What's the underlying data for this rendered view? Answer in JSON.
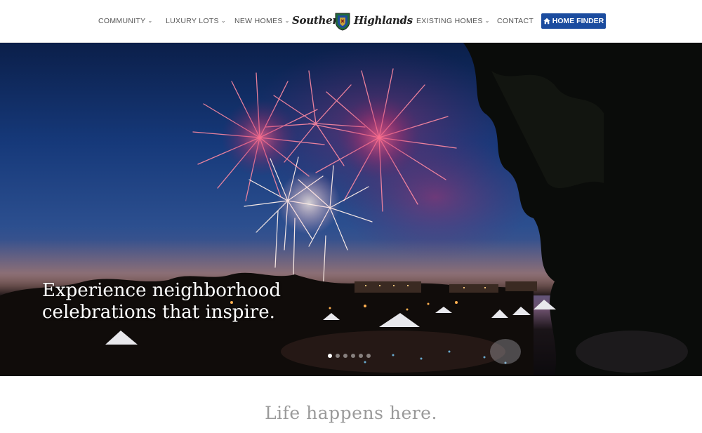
{
  "nav": {
    "items": [
      {
        "label": "COMMUNITY",
        "has_dropdown": true
      },
      {
        "label": "LUXURY LOTS",
        "has_dropdown": true
      },
      {
        "label": "NEW HOMES",
        "has_dropdown": true
      },
      {
        "label": "EXISTING HOMES",
        "has_dropdown": true
      },
      {
        "label": "CONTACT",
        "has_dropdown": false
      }
    ],
    "logo": {
      "left_text": "Southern",
      "right_text": "Highlands",
      "reg": "®"
    },
    "home_finder": {
      "label": "HOME FINDER",
      "icon": "home-icon",
      "color": "#1b4c9f"
    }
  },
  "hero": {
    "caption_line1": "Experience neighborhood",
    "caption_line2": "celebrations that inspire.",
    "slides": 6,
    "active_slide": 1
  },
  "intro": {
    "title": "Life happens here."
  },
  "colors": {
    "accent": "#1b4c9f",
    "tagline": "#9a9a9a"
  }
}
